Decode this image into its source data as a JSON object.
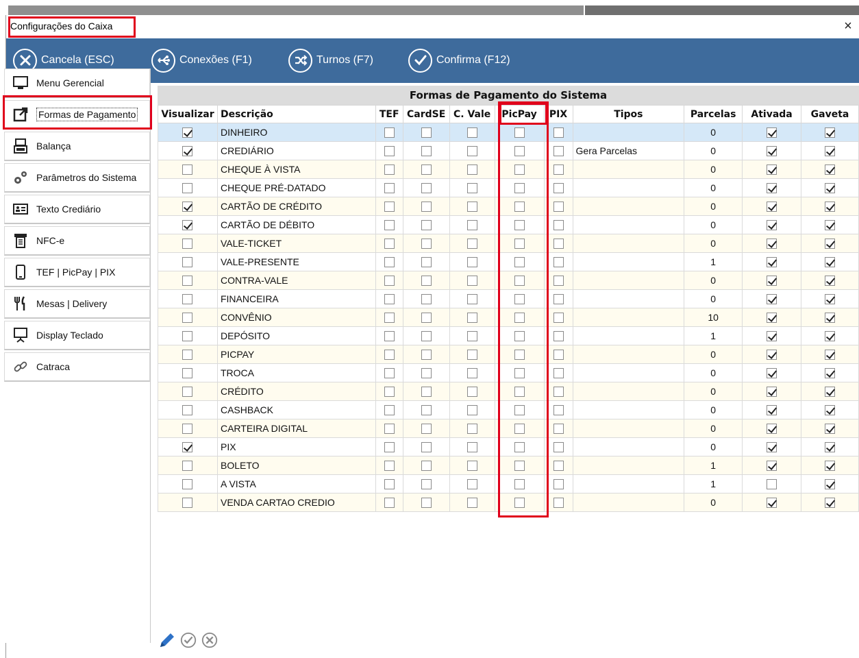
{
  "window": {
    "title": "Configurações do Caixa",
    "close_glyph": "×"
  },
  "toolbar": {
    "buttons": [
      {
        "label": "Cancela (ESC)",
        "icon": "x-circle-icon"
      },
      {
        "label": "Conexões (F1)",
        "icon": "connections-icon"
      },
      {
        "label": "Turnos (F7)",
        "icon": "shuffle-icon"
      },
      {
        "label": "Confirma (F12)",
        "icon": "check-circle-icon"
      }
    ],
    "color": "#3e6b9c"
  },
  "sidebar": {
    "items": [
      {
        "label": "Menu Gerencial",
        "icon": "monitor-icon"
      },
      {
        "label": "Formas de Pagamento",
        "icon": "external-link-icon"
      },
      {
        "label": "Balança",
        "icon": "scale-icon"
      },
      {
        "label": "Parâmetros do Sistema",
        "icon": "gears-icon"
      },
      {
        "label": "Texto Crediário",
        "icon": "id-card-icon"
      },
      {
        "label": "NFC-e",
        "icon": "receipt-icon"
      },
      {
        "label": "TEF | PicPay | PIX",
        "icon": "phone-icon"
      },
      {
        "label": "Mesas | Delivery",
        "icon": "fork-knife-icon"
      },
      {
        "label": "Display Teclado",
        "icon": "display-stand-icon"
      },
      {
        "label": "Catraca",
        "icon": "link-icon"
      }
    ]
  },
  "grid": {
    "title": "Formas de Pagamento do Sistema",
    "columns": [
      "Visualizar",
      "Descrição",
      "TEF",
      "CardSE",
      "C. Vale",
      "PicPay",
      "PIX",
      "Tipos",
      "Parcelas",
      "Ativada",
      "Gaveta"
    ],
    "rows": [
      {
        "visualizar": true,
        "descricao": "DINHEIRO",
        "tipos": "",
        "parcelas": "0",
        "ativada": true,
        "gaveta": true
      },
      {
        "visualizar": true,
        "descricao": "CREDIÁRIO",
        "tipos": "Gera Parcelas",
        "parcelas": "0",
        "ativada": true,
        "gaveta": true
      },
      {
        "visualizar": false,
        "descricao": "CHEQUE À VISTA",
        "tipos": "",
        "parcelas": "0",
        "ativada": true,
        "gaveta": true
      },
      {
        "visualizar": false,
        "descricao": "CHEQUE PRÉ-DATADO",
        "tipos": "",
        "parcelas": "0",
        "ativada": true,
        "gaveta": true
      },
      {
        "visualizar": true,
        "descricao": "CARTÃO DE CRÉDITO",
        "tipos": "",
        "parcelas": "0",
        "ativada": true,
        "gaveta": true
      },
      {
        "visualizar": true,
        "descricao": "CARTÃO DE DÉBITO",
        "tipos": "",
        "parcelas": "0",
        "ativada": true,
        "gaveta": true
      },
      {
        "visualizar": false,
        "descricao": "VALE-TICKET",
        "tipos": "",
        "parcelas": "0",
        "ativada": true,
        "gaveta": true
      },
      {
        "visualizar": false,
        "descricao": "VALE-PRESENTE",
        "tipos": "",
        "parcelas": "1",
        "ativada": true,
        "gaveta": true
      },
      {
        "visualizar": false,
        "descricao": "CONTRA-VALE",
        "tipos": "",
        "parcelas": "0",
        "ativada": true,
        "gaveta": true
      },
      {
        "visualizar": false,
        "descricao": "FINANCEIRA",
        "tipos": "",
        "parcelas": "0",
        "ativada": true,
        "gaveta": true
      },
      {
        "visualizar": false,
        "descricao": "CONVÊNIO",
        "tipos": "",
        "parcelas": "10",
        "ativada": true,
        "gaveta": true
      },
      {
        "visualizar": false,
        "descricao": "DEPÓSITO",
        "tipos": "",
        "parcelas": "1",
        "ativada": true,
        "gaveta": true
      },
      {
        "visualizar": false,
        "descricao": "PICPAY",
        "tipos": "",
        "parcelas": "0",
        "ativada": true,
        "gaveta": true
      },
      {
        "visualizar": false,
        "descricao": "TROCA",
        "tipos": "",
        "parcelas": "0",
        "ativada": true,
        "gaveta": true
      },
      {
        "visualizar": false,
        "descricao": "CRÉDITO",
        "tipos": "",
        "parcelas": "0",
        "ativada": true,
        "gaveta": true
      },
      {
        "visualizar": false,
        "descricao": "CASHBACK",
        "tipos": "",
        "parcelas": "0",
        "ativada": true,
        "gaveta": true
      },
      {
        "visualizar": false,
        "descricao": "CARTEIRA DIGITAL",
        "tipos": "",
        "parcelas": "0",
        "ativada": true,
        "gaveta": true
      },
      {
        "visualizar": true,
        "descricao": "PIX",
        "tipos": "",
        "parcelas": "0",
        "ativada": true,
        "gaveta": true
      },
      {
        "visualizar": false,
        "descricao": "BOLETO",
        "tipos": "",
        "parcelas": "1",
        "ativada": true,
        "gaveta": true
      },
      {
        "visualizar": false,
        "descricao": "A VISTA",
        "tipos": "",
        "parcelas": "1",
        "ativada": false,
        "gaveta": true
      },
      {
        "visualizar": false,
        "descricao": "VENDA CARTAO CREDIO",
        "tipos": "",
        "parcelas": "0",
        "ativada": true,
        "gaveta": true
      }
    ],
    "selected_row": 0
  },
  "bottom_tools": [
    "edit-pencil-icon",
    "confirm-check-icon",
    "cancel-x-icon"
  ],
  "highlight_color": "#e0001b"
}
